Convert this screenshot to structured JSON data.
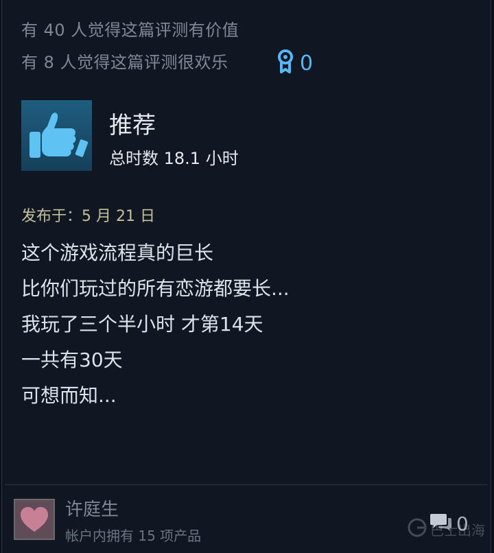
{
  "helpful": {
    "valuable_text": "有 40 人觉得这篇评测有价值",
    "funny_text": "有 8 人觉得这篇评测很欢乐"
  },
  "award": {
    "icon": "award-ribbon-icon",
    "count": "0",
    "color": "#59b7f5"
  },
  "recommendation": {
    "icon": "thumbs-up-icon",
    "verdict": "推荐",
    "hours": "总时数 18.1 小时"
  },
  "posted": "发布于：5 月 21 日",
  "review_lines": [
    "这个游戏流程真的巨长",
    "比你们玩过的所有恋游都要长...",
    "我玩了三个半小时 才第14天",
    "一共有30天",
    "可想而知..."
  ],
  "author": {
    "name": "许庭生",
    "owned": "帐户内拥有 15 项产品",
    "avatar": "heart-avatar"
  },
  "comments": {
    "icon": "comment-bubble-icon",
    "count": "0"
  },
  "watermark": {
    "text": "巴士出海",
    "icon": "g-logo-icon"
  }
}
